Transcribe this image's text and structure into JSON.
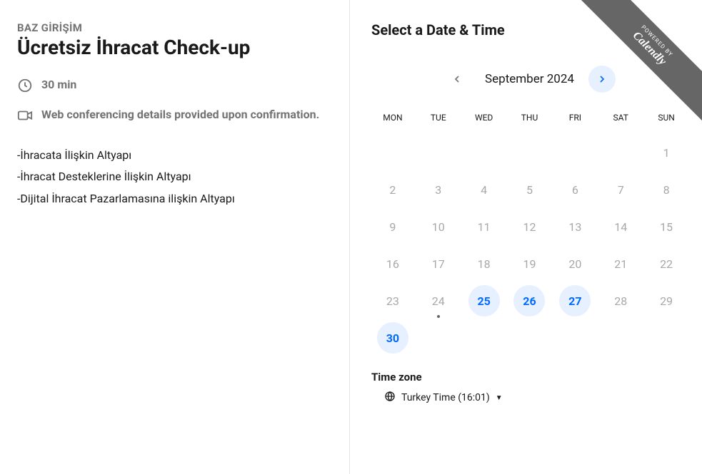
{
  "left": {
    "org": "BAZ GİRİŞİM",
    "title": "Ücretsiz İhracat Check-up",
    "duration": "30 min",
    "conferencing": "Web conferencing details provided upon confirmation.",
    "description_lines": [
      "-İhracata İlişkin Altyapı",
      "-İhracat Desteklerine İlişkin Altyapı",
      "-Dijital İhracat Pazarlamasına ilişkin Altyapı"
    ]
  },
  "right": {
    "heading": "Select a Date & Time",
    "month_label": "September 2024",
    "dow": [
      "MON",
      "TUE",
      "WED",
      "THU",
      "FRI",
      "SAT",
      "SUN"
    ],
    "days": [
      {
        "n": "",
        "available": false,
        "today": false
      },
      {
        "n": "",
        "available": false,
        "today": false
      },
      {
        "n": "",
        "available": false,
        "today": false
      },
      {
        "n": "",
        "available": false,
        "today": false
      },
      {
        "n": "",
        "available": false,
        "today": false
      },
      {
        "n": "",
        "available": false,
        "today": false
      },
      {
        "n": "1",
        "available": false,
        "today": false
      },
      {
        "n": "2",
        "available": false,
        "today": false
      },
      {
        "n": "3",
        "available": false,
        "today": false
      },
      {
        "n": "4",
        "available": false,
        "today": false
      },
      {
        "n": "5",
        "available": false,
        "today": false
      },
      {
        "n": "6",
        "available": false,
        "today": false
      },
      {
        "n": "7",
        "available": false,
        "today": false
      },
      {
        "n": "8",
        "available": false,
        "today": false
      },
      {
        "n": "9",
        "available": false,
        "today": false
      },
      {
        "n": "10",
        "available": false,
        "today": false
      },
      {
        "n": "11",
        "available": false,
        "today": false
      },
      {
        "n": "12",
        "available": false,
        "today": false
      },
      {
        "n": "13",
        "available": false,
        "today": false
      },
      {
        "n": "14",
        "available": false,
        "today": false
      },
      {
        "n": "15",
        "available": false,
        "today": false
      },
      {
        "n": "16",
        "available": false,
        "today": false
      },
      {
        "n": "17",
        "available": false,
        "today": false
      },
      {
        "n": "18",
        "available": false,
        "today": false
      },
      {
        "n": "19",
        "available": false,
        "today": false
      },
      {
        "n": "20",
        "available": false,
        "today": false
      },
      {
        "n": "21",
        "available": false,
        "today": false
      },
      {
        "n": "22",
        "available": false,
        "today": false
      },
      {
        "n": "23",
        "available": false,
        "today": false
      },
      {
        "n": "24",
        "available": false,
        "today": true
      },
      {
        "n": "25",
        "available": true,
        "today": false
      },
      {
        "n": "26",
        "available": true,
        "today": false
      },
      {
        "n": "27",
        "available": true,
        "today": false
      },
      {
        "n": "28",
        "available": false,
        "today": false
      },
      {
        "n": "29",
        "available": false,
        "today": false
      },
      {
        "n": "30",
        "available": true,
        "today": false
      }
    ],
    "timezone_label": "Time zone",
    "timezone_value": "Turkey Time (16:01)"
  },
  "ribbon": {
    "powered": "POWERED BY",
    "brand": "Calendly"
  }
}
